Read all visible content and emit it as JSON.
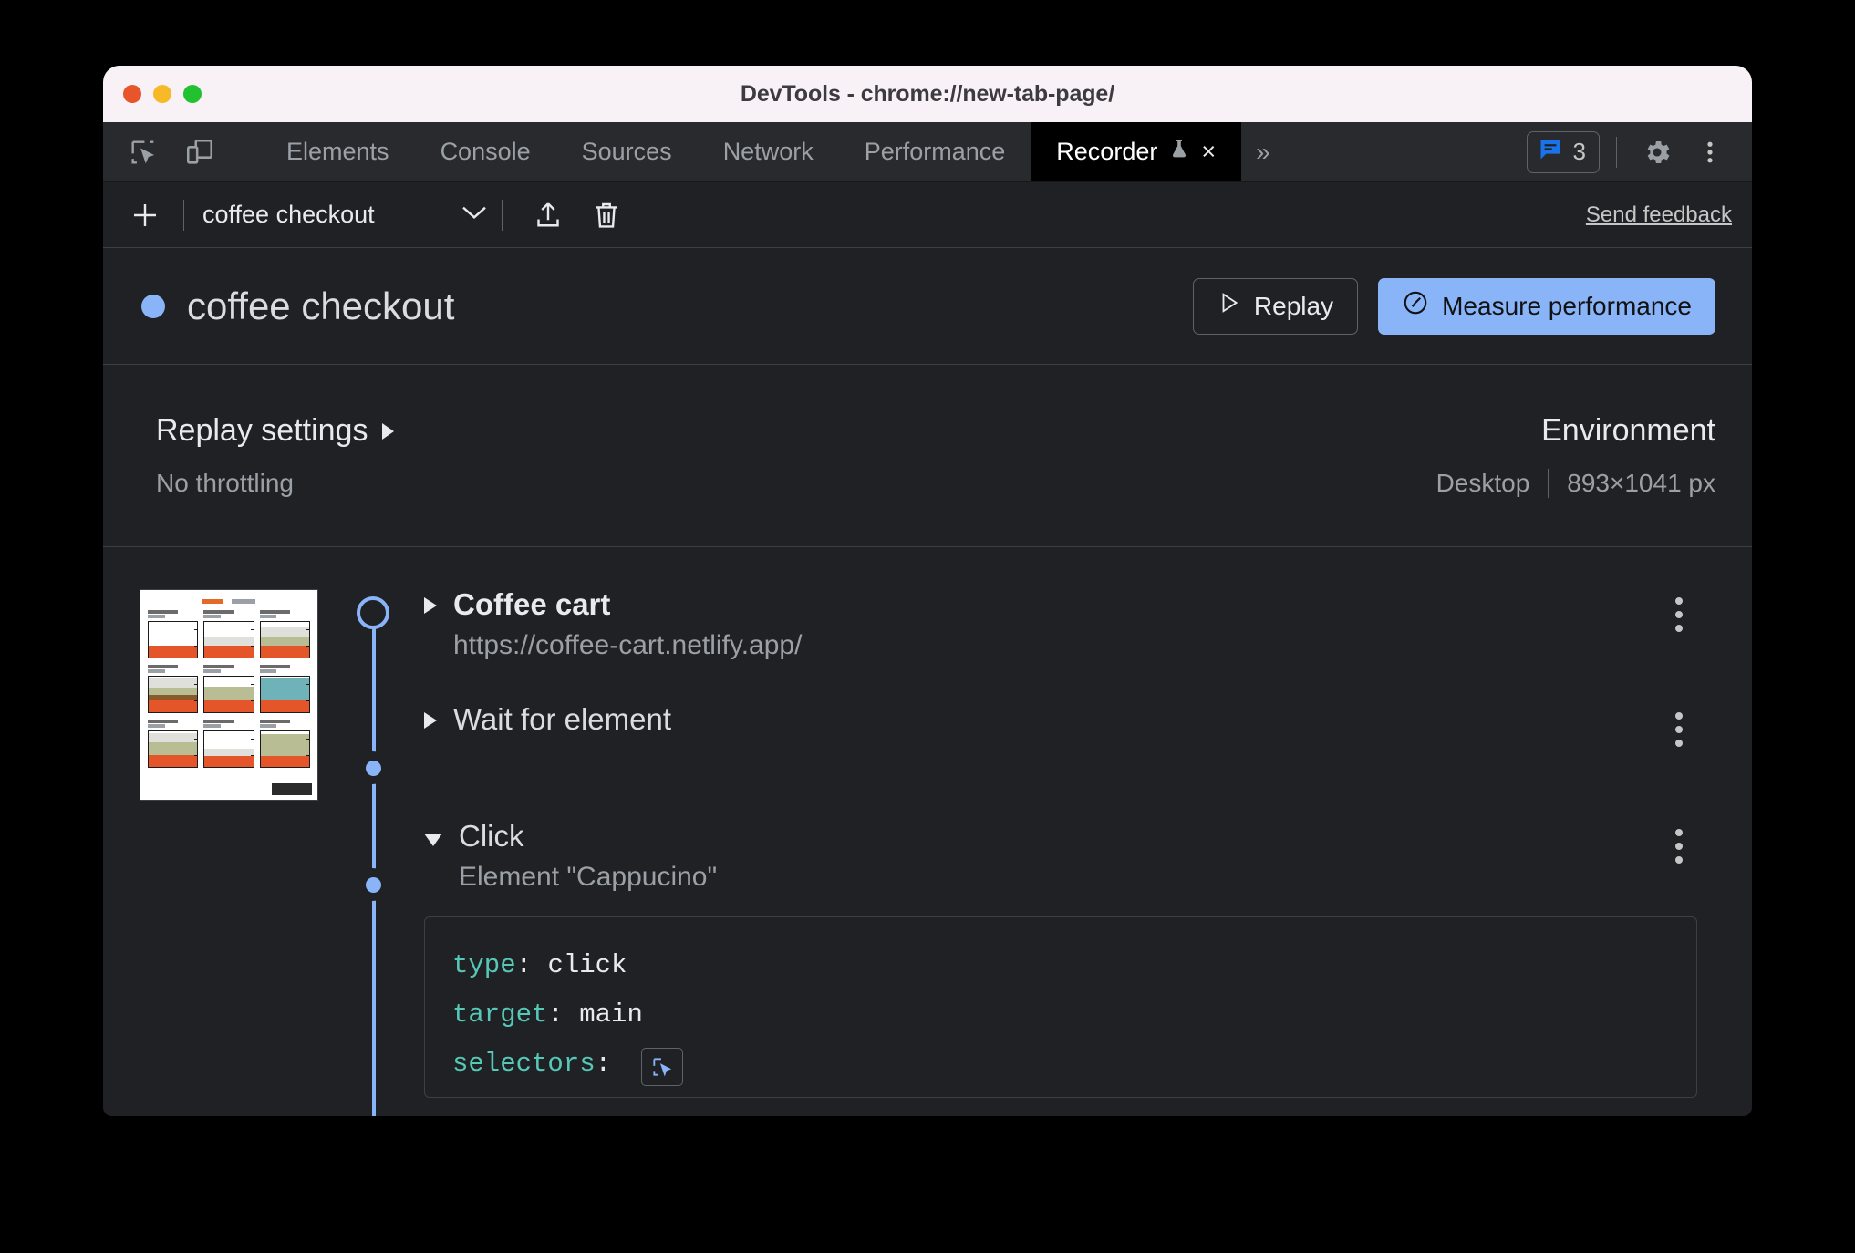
{
  "window": {
    "title": "DevTools - chrome://new-tab-page/",
    "traffic_lights": [
      "close",
      "minimize",
      "zoom"
    ]
  },
  "devtools_tabbar": {
    "left_icons": [
      "inspect-element-icon",
      "device-toolbar-icon"
    ],
    "tabs": [
      {
        "label": "Elements",
        "active": false
      },
      {
        "label": "Console",
        "active": false
      },
      {
        "label": "Sources",
        "active": false
      },
      {
        "label": "Network",
        "active": false
      },
      {
        "label": "Performance",
        "active": false
      },
      {
        "label": "Recorder",
        "active": true,
        "experimental": true,
        "close": "×"
      }
    ],
    "more_tabs": "»",
    "messages_count": "3",
    "right_icons": [
      "settings-gear-icon",
      "more-options-icon"
    ]
  },
  "recorder_toolbar": {
    "add_label": "+",
    "selected_recording": "coffee checkout",
    "chevron": "⌄",
    "export_icon": "export-icon",
    "delete_icon": "delete-icon",
    "feedback_label": "Send feedback"
  },
  "recording_header": {
    "title": "coffee checkout",
    "status_color": "#8ab4f8",
    "replay_label": "Replay",
    "replay_icon": "▷",
    "measure_label": "Measure performance",
    "measure_icon": "performance-gauge-icon",
    "primary_color": "#8ab4f8"
  },
  "settings": {
    "replay_settings_label": "Replay settings",
    "replay_settings_caret": "▶",
    "throttling_value": "No throttling",
    "environment_label": "Environment",
    "environment_device": "Desktop",
    "environment_viewport": "893×1041 px"
  },
  "thumbnail": {
    "alt": "coffee cart page screenshot"
  },
  "steps": [
    {
      "title": "Coffee cart",
      "subtitle": "https://coffee-cart.netlify.app/",
      "expanded": false,
      "marker": "hollow",
      "menu": "more-options-icon"
    },
    {
      "title": "Wait for element",
      "subtitle": "",
      "expanded": false,
      "marker": "solid",
      "menu": "more-options-icon"
    },
    {
      "title": "Click",
      "subtitle": "Element \"Cappucino\"",
      "expanded": true,
      "marker": "solid",
      "menu": "more-options-icon"
    }
  ],
  "step_code": {
    "lines": [
      {
        "key": "type",
        "value": "click"
      },
      {
        "key": "target",
        "value": "main"
      },
      {
        "key": "selectors",
        "value": "",
        "has_inspect_button": true
      }
    ],
    "inspect_icon": "select-element-icon"
  }
}
